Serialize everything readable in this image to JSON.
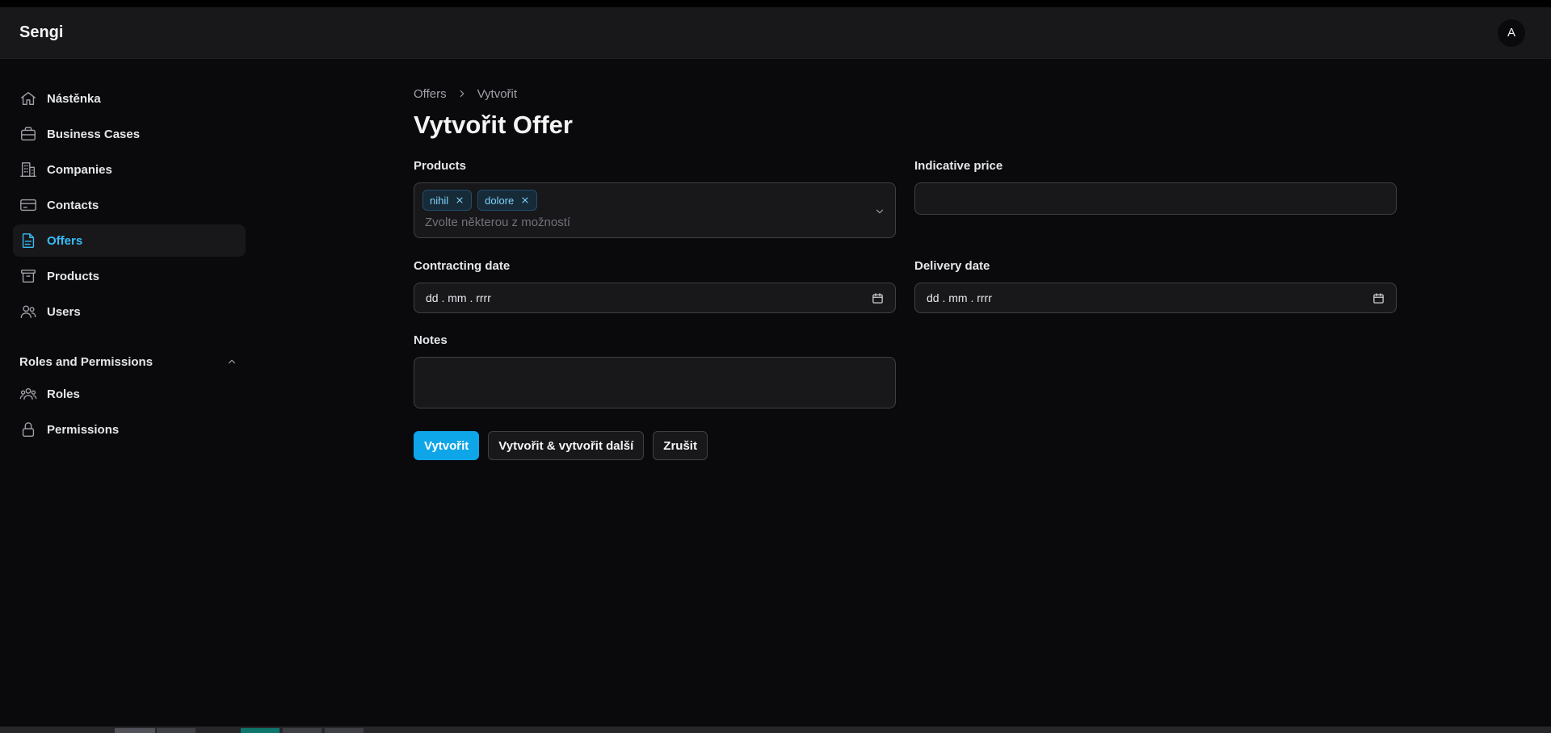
{
  "app": {
    "brand": "Sengi",
    "avatar_initial": "A"
  },
  "sidebar": {
    "items": [
      {
        "label": "Nástěnka",
        "icon": "home-icon",
        "active": false
      },
      {
        "label": "Business Cases",
        "icon": "briefcase-icon",
        "active": false
      },
      {
        "label": "Companies",
        "icon": "building-icon",
        "active": false
      },
      {
        "label": "Contacts",
        "icon": "card-icon",
        "active": false
      },
      {
        "label": "Offers",
        "icon": "document-icon",
        "active": true
      },
      {
        "label": "Products",
        "icon": "archive-box-icon",
        "active": false
      },
      {
        "label": "Users",
        "icon": "users-icon",
        "active": false
      }
    ],
    "group": {
      "label": "Roles and Permissions",
      "items": [
        {
          "label": "Roles",
          "icon": "user-group-icon"
        },
        {
          "label": "Permissions",
          "icon": "lock-icon"
        }
      ]
    }
  },
  "breadcrumb": {
    "parent": "Offers",
    "current": "Vytvořit"
  },
  "page": {
    "title": "Vytvořit Offer"
  },
  "form": {
    "products": {
      "label": "Products",
      "selected": [
        "nihil",
        "dolore"
      ],
      "placeholder": "Zvolte některou z možností"
    },
    "indicative_price": {
      "label": "Indicative price",
      "value": ""
    },
    "contracting_date": {
      "label": "Contracting date",
      "placeholder": "dd . mm . rrrr"
    },
    "delivery_date": {
      "label": "Delivery date",
      "placeholder": "dd . mm . rrrr"
    },
    "notes": {
      "label": "Notes",
      "value": ""
    }
  },
  "actions": {
    "create": "Vytvořit",
    "create_another": "Vytvořit & vytvořit další",
    "cancel": "Zrušit"
  },
  "colors": {
    "accent": "#0ea5e9",
    "active_nav": "#38bdf8",
    "background": "#0a0a0c",
    "surface": "#18181b"
  }
}
